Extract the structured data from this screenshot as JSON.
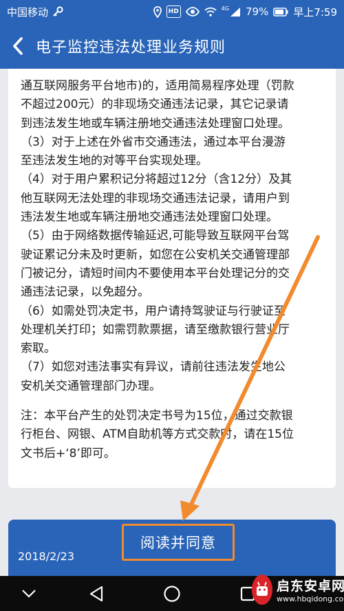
{
  "status_bar": {
    "carrier": "中国移动",
    "battery": "79%",
    "time": "早上7:59",
    "network": "4G",
    "hd": "HD"
  },
  "header": {
    "title": "电子监控违法处理业务规则"
  },
  "rules": {
    "lines": [
      "通互联网服务平台地市)的，适用简易程序处理（罚款",
      "不超过200元）的非现场交通违法记录，其它记录请",
      "到违法发生地或车辆注册地交通违法处理窗口处理。",
      "（3）对于上述在外省市交通违法，通过本平台漫游",
      "至违法发生地的对等平台实现处理。",
      "（4）对于用户累积记分将超过12分（含12分）及其",
      "他互联网无法处理的非现场交通违法记录，请用户到",
      "违法发生地或车辆注册地交通违法处理窗口处理。",
      "（5）由于网络数据传输延迟,可能导致互联网平台驾",
      "驶证累记分未及时更新，如您在公安机关交通管理部",
      "门被记分，请短时间内不要使用本平台处理记分的交",
      "通违法记录，以免超分。",
      "（6）如需处罚决定书，用户请持驾驶证与行驶证至",
      "处理机关打印；如需罚款票据，请至缴款银行营业厅",
      "索取。",
      "（7）如您对违法事实有异议，请前往违法发生地公",
      "安机关交通管理部门办理。"
    ],
    "note_lines": [
      "注：本平台产生的处罚决定书号为15位，通过交款银",
      "行柜台、网银、ATM自助机等方式交款时，请在15位",
      "文书后+‘8’即可。"
    ]
  },
  "agree": {
    "button_label": "阅读并同意",
    "date": "2018/2/23"
  },
  "watermark": {
    "name": "启东安卓网",
    "url": "www.hbqidong.com"
  },
  "colors": {
    "brand_blue": "#2a64b8",
    "annotation_orange": "#f28a2e"
  }
}
